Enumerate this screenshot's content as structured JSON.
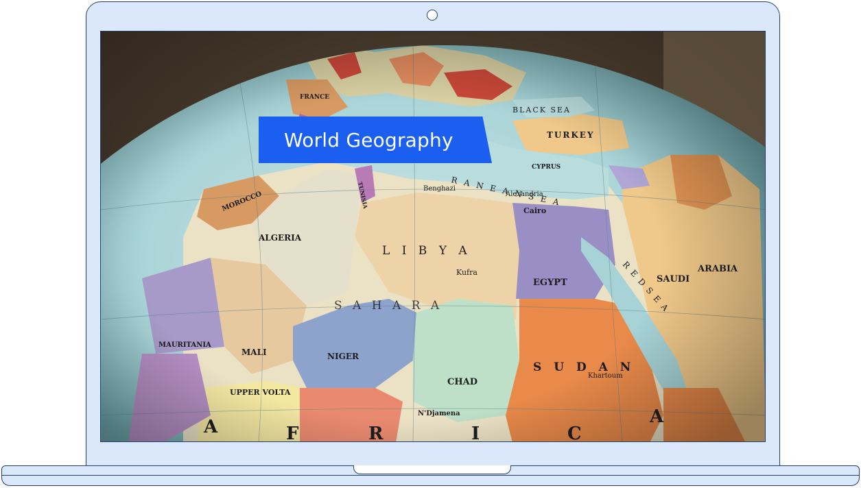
{
  "banner": {
    "title": "World Geography"
  },
  "map": {
    "description_icon": "globe-photo",
    "labels": {
      "algeria": "ALGERIA",
      "libya": "L I B Y A",
      "egypt": "EGYPT",
      "sudan": "S U D A N",
      "niger": "NIGER",
      "chad": "CHAD",
      "mali": "MALI",
      "mauritania": "MAURITANIA",
      "morocco": "MOROCCO",
      "saudi": "SAUDI",
      "arabia": "ARABIA",
      "turkey": "TURKEY",
      "cyprus": "CYPRUS",
      "black_sea": "BLACK SEA",
      "sahara": "S A H A R A",
      "tunisia": "TUNISIA",
      "france": "FRANCE",
      "upper_volta": "UPPER VOLTA",
      "red_sea": "R E D   S E A",
      "mediterranean": "R A N E A N   S E A",
      "cairo": "Cairo",
      "alexandria": "Alexandria",
      "benghazi": "Benghazi",
      "khartoum": "Khartoum",
      "ndjamena": "N'Djamena",
      "kufra": "Kufra"
    }
  },
  "colors": {
    "accent": "#1a5ff0",
    "device_fill": "#dbe8fb",
    "device_stroke": "#1f3d73"
  }
}
